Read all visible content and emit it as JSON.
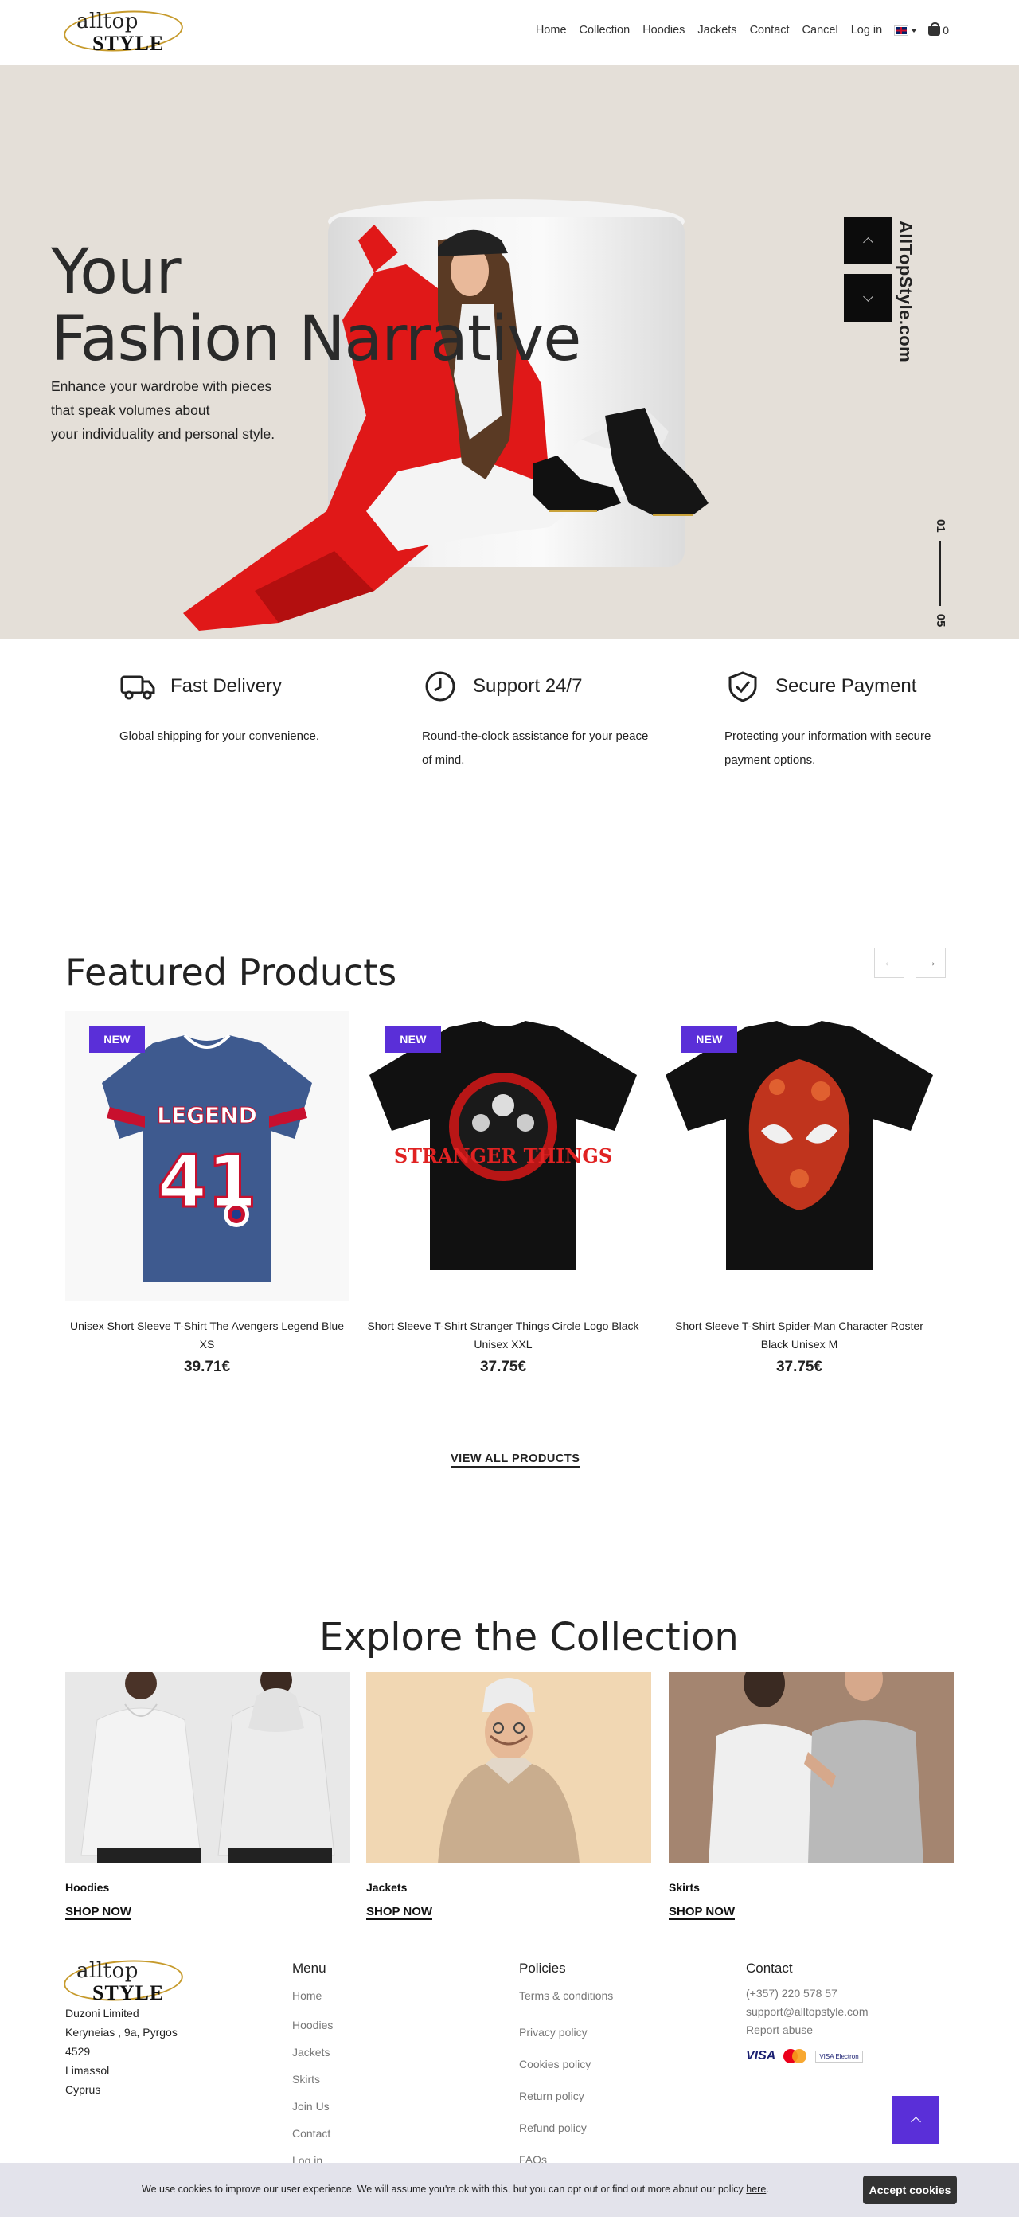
{
  "brand": {
    "logo_top": "alltop",
    "logo_bottom": "STYLE"
  },
  "nav": {
    "items": [
      "Home",
      "Collection",
      "Hoodies",
      "Jackets",
      "Contact",
      "Cancel",
      "Log in"
    ],
    "cart_count": "0"
  },
  "hero": {
    "title_line1": "Your",
    "title_line2": "Fashion Narrative",
    "subtitle_line1": "Enhance your wardrobe with pieces",
    "subtitle_line2": "that speak volumes about",
    "subtitle_line3": "your individuality and personal style.",
    "vertical_text": "AllTopStyle.com",
    "slide_current": "01",
    "slide_total": "05"
  },
  "features": [
    {
      "icon": "truck-icon",
      "title": "Fast Delivery",
      "text": "Global shipping for your convenience."
    },
    {
      "icon": "clock-icon",
      "title": "Support 24/7",
      "text": "Round-the-clock assistance for your peace of mind."
    },
    {
      "icon": "shield-check-icon",
      "title": "Secure Payment",
      "text": "Protecting your information with secure payment options."
    }
  ],
  "featured": {
    "title": "Featured Products",
    "badge": "NEW",
    "products": [
      {
        "name": "Unisex Short Sleeve T-Shirt The Avengers Legend Blue XS",
        "price": "39.71€",
        "shirt_color": "#3e5a8f",
        "print_text": "LEGEND",
        "print_number": "41"
      },
      {
        "name": "Short Sleeve T-Shirt Stranger Things Circle Logo Black Unisex XXL",
        "price": "37.75€",
        "shirt_color": "#111111",
        "print_text": "STRANGER THINGS"
      },
      {
        "name": "Short Sleeve T-Shirt Spider-Man Character Roster Black Unisex M",
        "price": "37.75€",
        "shirt_color": "#111111"
      }
    ],
    "view_all": "VIEW ALL PRODUCTS"
  },
  "collection": {
    "title": "Explore the Collection",
    "shop_label": "SHOP NOW",
    "items": [
      {
        "label": "Hoodies",
        "bg": "#e8e8e8"
      },
      {
        "label": "Jackets",
        "bg": "#f1d7b3"
      },
      {
        "label": "Skirts",
        "bg": "#a48570"
      }
    ]
  },
  "footer": {
    "address": [
      "Duzoni Limited",
      "Kerynеias , 9a, Pyrgos",
      "4529",
      "Limassol",
      "Cyprus"
    ],
    "menu_title": "Menu",
    "menu": [
      "Home",
      "Hoodies",
      "Jackets",
      "Skirts",
      "Join Us",
      "Contact",
      "Log in"
    ],
    "policies_title": "Policies",
    "policies": [
      "Terms & conditions",
      "Privacy policy",
      "Cookies policy",
      "Return policy",
      "Refund policy",
      "FAQs"
    ],
    "contact_title": "Contact",
    "phone": "(+357) 220 578 57",
    "email": "support@alltopstyle.com",
    "report": "Report abuse",
    "visa": "VISA",
    "electron": "VISA Electron"
  },
  "cookie": {
    "text": "We use cookies to improve our user experience. We will assume you're ok with this, but you can opt out or find out more about our policy",
    "link": "here",
    "button": "Accept cookies"
  },
  "colors": {
    "accent": "#5a2fd8",
    "hero_bg": "#e4dfd8",
    "coat_red": "#e01818"
  }
}
